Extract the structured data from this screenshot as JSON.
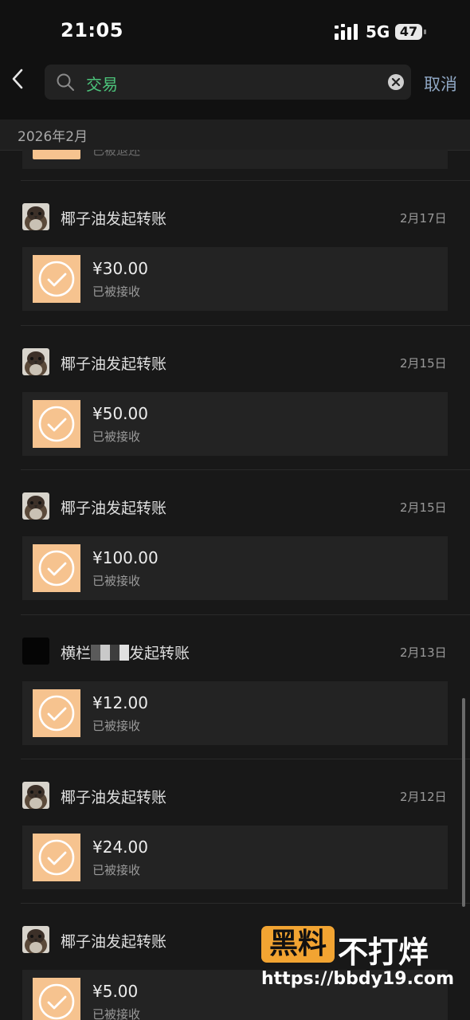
{
  "status": {
    "time": "21:05",
    "network": "5G",
    "battery": "47"
  },
  "header": {
    "search_value": "交易",
    "cancel_label": "取消"
  },
  "month_label": "2026年2月",
  "partial_status": "已被退还",
  "records": [
    {
      "title": "椰子油发起转账",
      "date": "2月17日",
      "amount": "¥30.00",
      "status": "已被接收",
      "avatar": "sparrow"
    },
    {
      "title": "椰子油发起转账",
      "date": "2月15日",
      "amount": "¥50.00",
      "status": "已被接收",
      "avatar": "sparrow"
    },
    {
      "title": "椰子油发起转账",
      "date": "2月15日",
      "amount": "¥100.00",
      "status": "已被接收",
      "avatar": "sparrow"
    },
    {
      "title": "横栏",
      "title_suffix": "发起转账",
      "date": "2月13日",
      "amount": "¥12.00",
      "status": "已被接收",
      "avatar": "black"
    },
    {
      "title": "椰子油发起转账",
      "date": "2月12日",
      "amount": "¥24.00",
      "status": "已被接收",
      "avatar": "sparrow"
    },
    {
      "title": "椰子油发起转账",
      "date": "",
      "amount": "¥5.00",
      "status": "已被接收",
      "avatar": "sparrow"
    }
  ],
  "watermark": {
    "logo": "黑料",
    "text": "不打烊",
    "url": "https://bbdy19.com"
  },
  "colors": {
    "background": "#181818",
    "card": "#232323",
    "transfer_icon": "#f6c38f",
    "search_text": "#4cc37a",
    "cancel": "#8fa7c4"
  }
}
